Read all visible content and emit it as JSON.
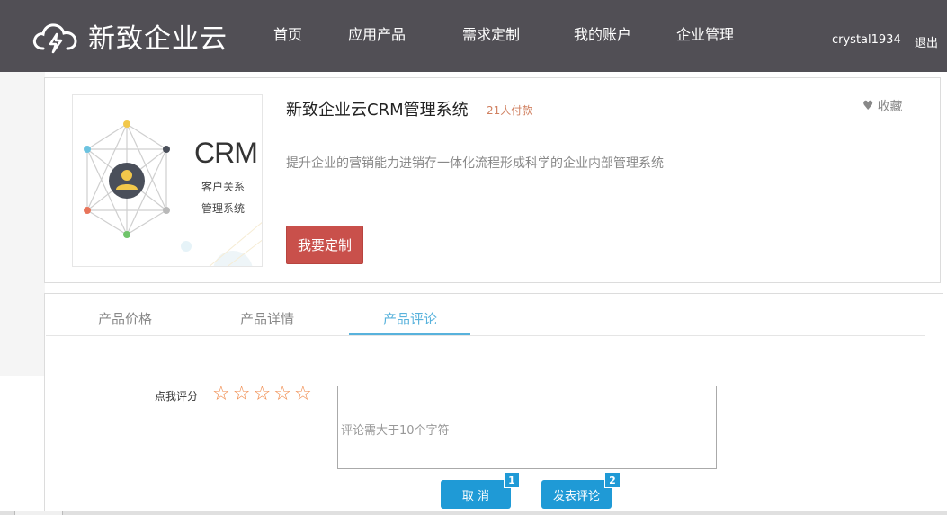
{
  "header": {
    "logo_text": "新致企业云",
    "nav": [
      "首页",
      "应用产品",
      "需求定制",
      "我的账户",
      "企业管理"
    ],
    "username": "crystal1934",
    "logout_label": "退出"
  },
  "product": {
    "title": "新致企业云CRM管理系统",
    "pay_count": "21人付款",
    "favorite_label": "收藏",
    "description": "提升企业的营销能力进销存一体化流程形成科学的企业内部管理系统",
    "custom_button_label": "我要定制",
    "image": {
      "label": "CRM",
      "line1": "客户关系",
      "line2": "管理系统"
    }
  },
  "tabs": {
    "items": [
      "产品价格",
      "产品详情",
      "产品评论"
    ],
    "active": "产品评论"
  },
  "review": {
    "rating_label": "点我评分",
    "stars": 5,
    "rating_value": 0,
    "comment_placeholder": "评论需大于10个字符",
    "comment_value": "",
    "cancel_label": "取 消",
    "cancel_badge": "1",
    "submit_label": "发表评论",
    "submit_badge": "2"
  },
  "colors": {
    "header_bg": "#514f55",
    "accent_red": "#c9504b",
    "accent_blue": "#1f9ad6",
    "star": "#f08a4b",
    "tab_active": "#58b2dc"
  }
}
